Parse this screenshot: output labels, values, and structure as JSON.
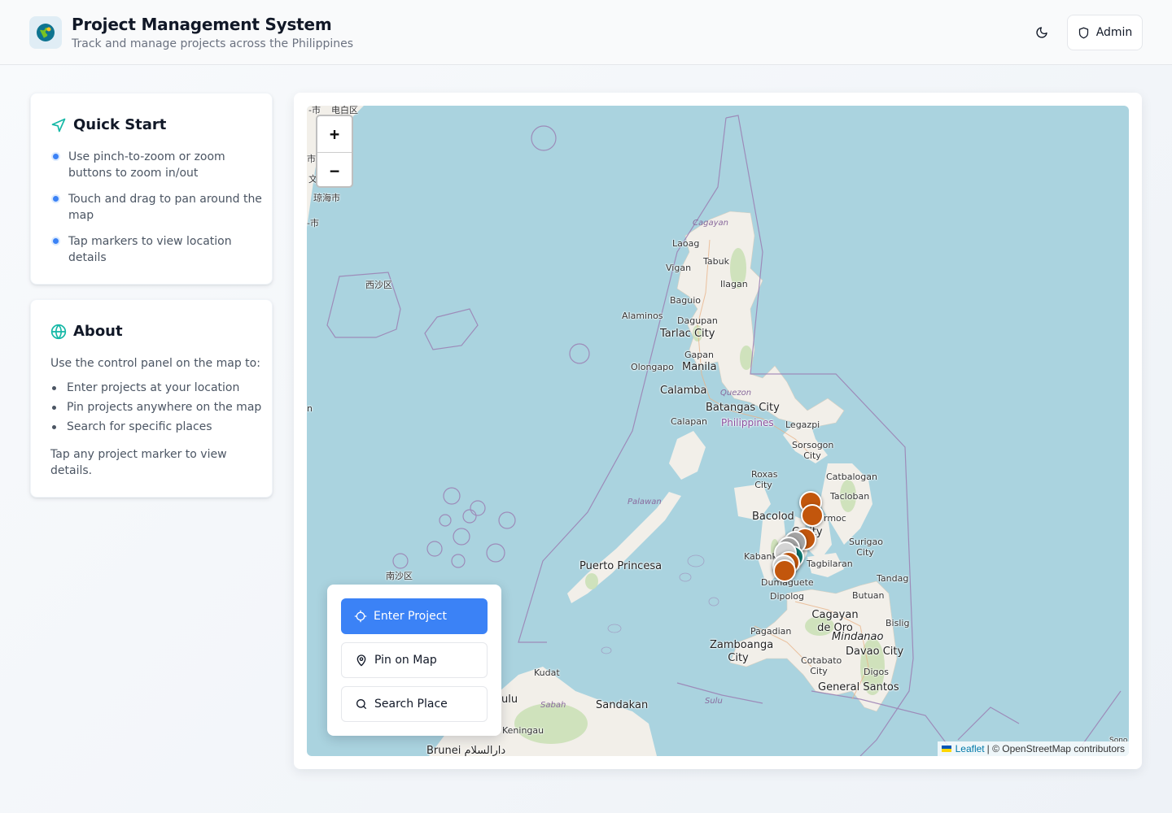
{
  "header": {
    "title": "Project Management System",
    "subtitle": "Track and manage projects across the Philippines",
    "admin_label": "Admin"
  },
  "quick_start": {
    "title": "Quick Start",
    "items": [
      "Use pinch-to-zoom or zoom buttons to zoom in/out",
      "Touch and drag to pan around the map",
      "Tap markers to view location details"
    ]
  },
  "about": {
    "title": "About",
    "intro": "Use the control panel on the map to:",
    "items": [
      "Enter projects at your location",
      "Pin projects anywhere on the map",
      "Search for specific places"
    ],
    "footer": "Tap any project marker to view details."
  },
  "map": {
    "zoom_in": "+",
    "zoom_out": "−",
    "attribution_link": "Leaflet",
    "attribution_text": "| © OpenStreetMap contributors",
    "labels": {
      "cagayan": "Cagayan",
      "laoag": "Laoag",
      "tabuk": "Tabuk",
      "vigan": "Vigan",
      "ilagan": "Ilagan",
      "baguio": "Baguio",
      "alaminos": "Alaminos",
      "dagupan": "Dagupan",
      "tarlac": "Tarlac City",
      "gapan": "Gapan",
      "olongapo": "Olongapo",
      "manila": "Manila",
      "calamba": "Calamba",
      "quezon": "Quezon",
      "batangas": "Batangas City",
      "calapan": "Calapan",
      "philippines": "Philippines",
      "legazpi": "Legazpi",
      "sorsogon": "Sorsogon City",
      "catbalogan": "Catbalogan",
      "tacloban": "Tacloban",
      "ormoc": "rmoc",
      "roxas": "Roxas City",
      "bacolod": "Bacolod",
      "cebu": "Ce      ity",
      "surigao": "Surigao City",
      "kabank": "Kabank",
      "tagbilaran": "Tagbilaran",
      "tandag": "Tandag",
      "dumaguete": "Dumaguete",
      "butuan": "Butuan",
      "dipolog": "Dipolog",
      "cagayan_de_oro": "Cagayan de Oro",
      "pagadian": "Pagadian",
      "mindanao": "Mindanao",
      "bislig": "Bislig",
      "zamboanga": "Zamboanga City",
      "cotabato": "Cotabato City",
      "davao": "Davao City",
      "digos": "Digos",
      "general_santos": "General Santos",
      "palawan": "Palawan",
      "puerto_princesa": "Puerto Princesa",
      "kudat": "Kudat",
      "sabah": "Sabah",
      "sandakan": "Sandakan",
      "sulu_region": "Sulu",
      "keningau": "Keningau",
      "brunei": "Brunei دارالسلام",
      "ulu": "ulu",
      "xisha": "西沙区",
      "nansha": "南沙区",
      "haikou": "琼海市",
      "dianbai": "电白区",
      "corner_a": "-市",
      "corner_b": "市",
      "corner_c": "文",
      "corner_d": "-市",
      "corner_e": "n",
      "corner_f": "Sono"
    }
  },
  "controls": {
    "enter_project": "Enter Project",
    "pin_on_map": "Pin on Map",
    "search_place": "Search Place"
  },
  "colors": {
    "accent": "#3b82f6",
    "teal_icon": "#14b8a6",
    "marker_orange": "#c2560c",
    "marker_teal": "#0f766e",
    "water": "#aad3df",
    "land": "#f2efe9"
  }
}
